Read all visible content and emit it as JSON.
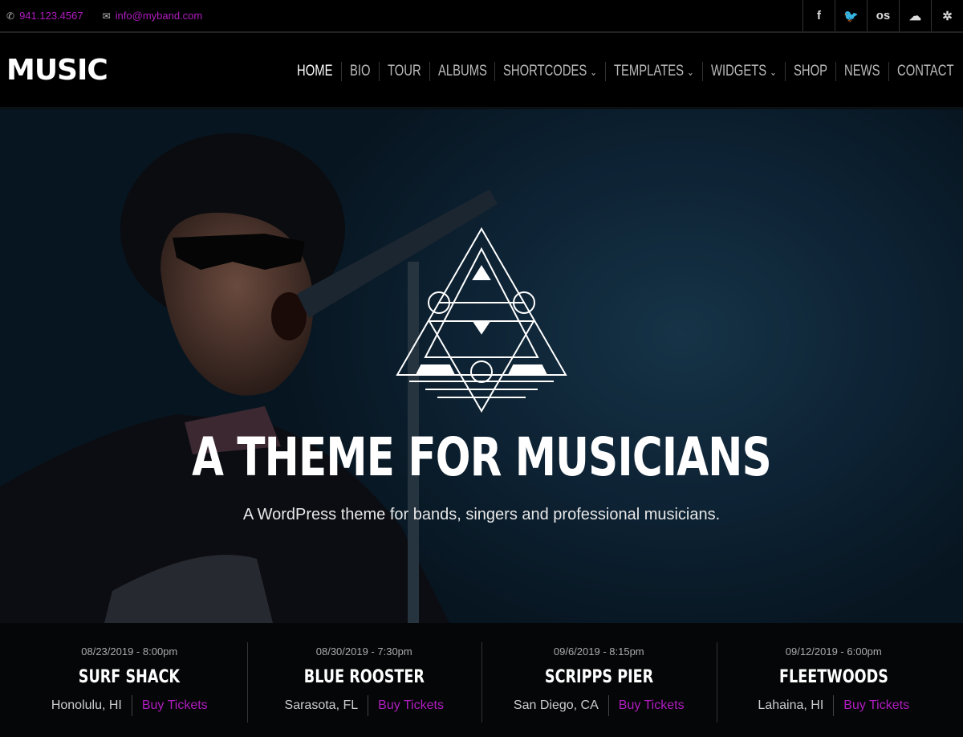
{
  "topbar": {
    "phone": "941.123.4567",
    "email": "info@myband.com",
    "social": [
      {
        "icon": "facebook-icon",
        "glyph": "f"
      },
      {
        "icon": "twitter-icon",
        "glyph": "🐦"
      },
      {
        "icon": "lastfm-icon",
        "glyph": "os"
      },
      {
        "icon": "soundcloud-icon",
        "glyph": "☁"
      },
      {
        "icon": "yelp-icon",
        "glyph": "✲"
      }
    ]
  },
  "header": {
    "logo": "MUSIC",
    "nav": [
      {
        "label": "HOME",
        "active": true
      },
      {
        "label": "BIO"
      },
      {
        "label": "TOUR"
      },
      {
        "label": "ALBUMS"
      },
      {
        "label": "SHORTCODES",
        "dropdown": true
      },
      {
        "label": "TEMPLATES",
        "dropdown": true
      },
      {
        "label": "WIDGETS",
        "dropdown": true
      },
      {
        "label": "SHOP"
      },
      {
        "label": "NEWS"
      },
      {
        "label": "CONTACT"
      }
    ]
  },
  "hero": {
    "title": "A THEME FOR MUSICIANS",
    "subtitle": "A WordPress theme for bands, singers and professional musicians."
  },
  "events": [
    {
      "date": "08/23/2019 - 8:00pm",
      "venue": "SURF SHACK",
      "city": "Honolulu, HI",
      "link": "Buy Tickets"
    },
    {
      "date": "08/30/2019 - 7:30pm",
      "venue": "BLUE ROOSTER",
      "city": "Sarasota, FL",
      "link": "Buy Tickets"
    },
    {
      "date": "09/6/2019 - 8:15pm",
      "venue": "SCRIPPS PIER",
      "city": "San Diego, CA",
      "link": "Buy Tickets"
    },
    {
      "date": "09/12/2019 - 6:00pm",
      "venue": "FLEETWOODS",
      "city": "Lahaina, HI",
      "link": "Buy Tickets"
    }
  ],
  "colors": {
    "accent": "#b01cc0",
    "background": "#000000",
    "hero": "#0d2233"
  }
}
